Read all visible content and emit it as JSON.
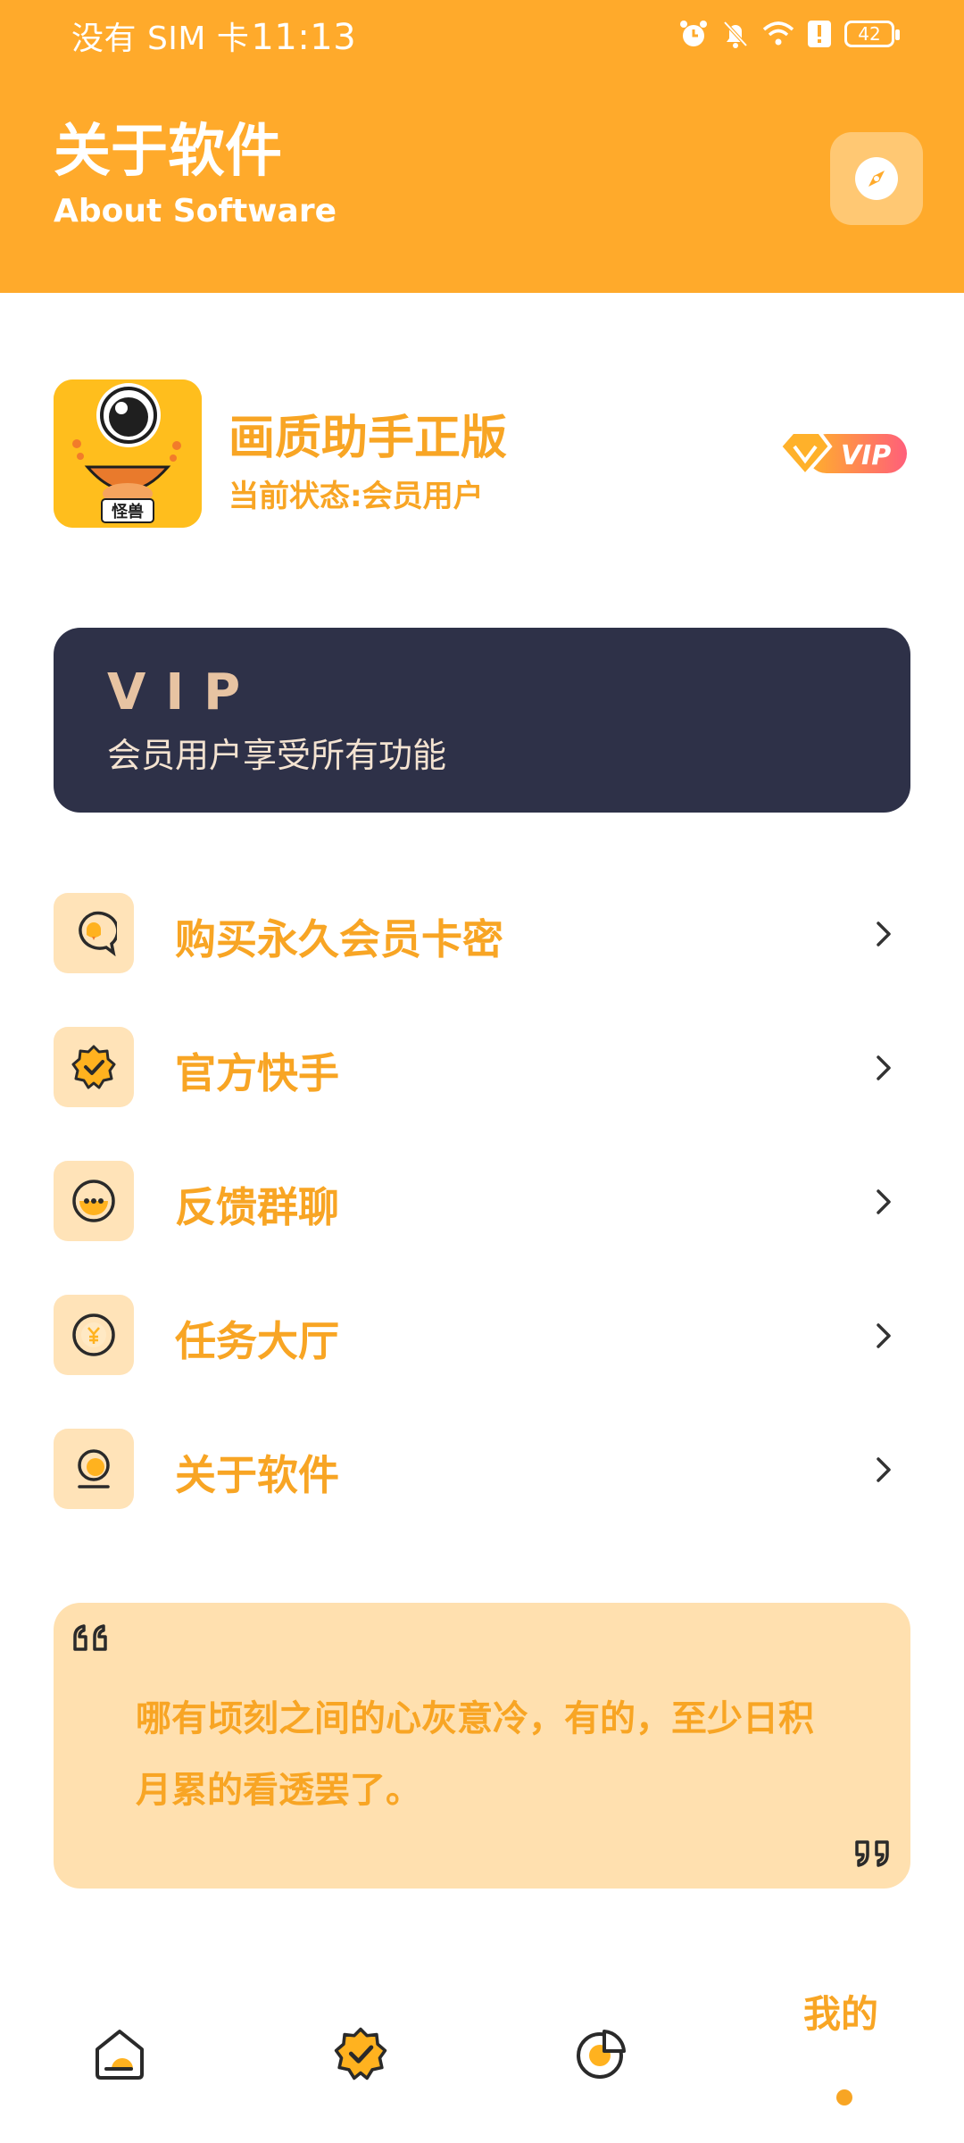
{
  "status_bar": {
    "carrier": "没有 SIM 卡",
    "time": "11:13",
    "battery": "42",
    "icons": [
      "alarm-icon",
      "mute-bell-icon",
      "wifi-icon",
      "alert-icon",
      "battery-icon"
    ]
  },
  "header": {
    "title": "关于软件",
    "subtitle": "About Software",
    "action_icon": "compass-icon",
    "color": "#FFAA2B"
  },
  "app": {
    "name": "画质助手正版",
    "status": "当前状态:会员用户",
    "icon_label": "怪兽",
    "badge": "VIP"
  },
  "vip_card": {
    "title": "VIP",
    "description": "会员用户享受所有功能"
  },
  "menu": {
    "items": [
      {
        "label": "购买永久会员卡密",
        "icon": "chat-icon"
      },
      {
        "label": "官方快手",
        "icon": "verified-icon"
      },
      {
        "label": "反馈群聊",
        "icon": "message-icon"
      },
      {
        "label": "任务大厅",
        "icon": "yen-coin-icon"
      },
      {
        "label": "关于软件",
        "icon": "about-icon"
      }
    ]
  },
  "quote": {
    "text": "哪有顷刻之间的心灰意冷，有的，至少日积月累的看透罢了。"
  },
  "bottom_nav": {
    "items": [
      "home-icon",
      "verified-icon",
      "chart-icon"
    ],
    "active_label": "我的"
  },
  "colors": {
    "accent": "#F8A524",
    "header": "#FFAA2B",
    "card_dark": "#2E3148",
    "icon_bg": "#FFE3B8",
    "quote_bg": "#FFE0AF"
  }
}
